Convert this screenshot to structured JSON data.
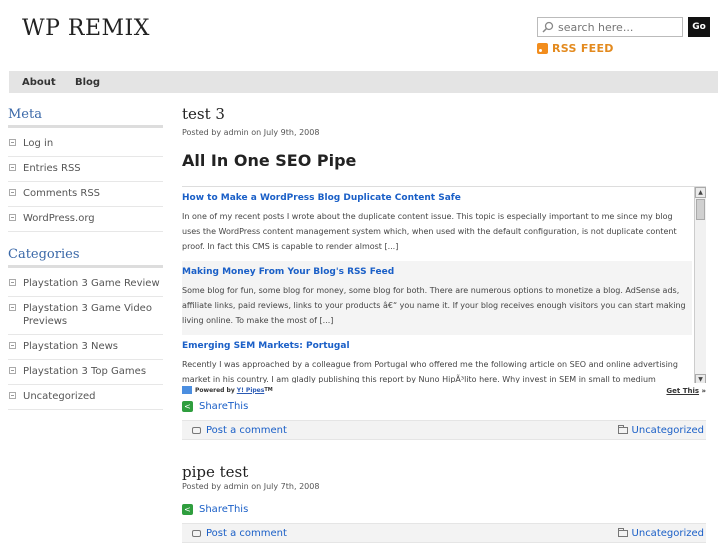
{
  "header": {
    "logo": "WP REMIX",
    "search_placeholder": "search here...",
    "go_label": "Go",
    "rss_label": "RSS FEED"
  },
  "nav": {
    "about": "About",
    "blog": "Blog"
  },
  "sidebar": {
    "meta_title": "Meta",
    "meta_items": [
      "Log in",
      "Entries RSS",
      "Comments RSS",
      "WordPress.org"
    ],
    "categories_title": "Categories",
    "category_items": [
      "Playstation 3 Game Review",
      "Playstation 3 Game Video Previews",
      "Playstation 3 News",
      "Playstation 3 Top Games",
      "Uncategorized"
    ]
  },
  "posts": [
    {
      "title": "test 3",
      "meta": "Posted by admin on July 9th, 2008",
      "pipe_title": "All In One SEO Pipe",
      "pipe_items": [
        {
          "title": "How to Make a WordPress Blog Duplicate Content Safe",
          "desc": "In one of my recent posts I wrote about the duplicate content issue. This topic is especially important to me since my blog uses the WordPress content management system which, when used with the default configuration, is not duplicate content proof. In fact this CMS is capable to render almost [...]"
        },
        {
          "title": "Making Money From Your Blog's RSS Feed",
          "desc": "Some blog for fun, some blog for money, some blog for both. There are numerous options to monetize a blog. AdSense ads, affiliate links, paid reviews, links to your products â€“ you name it. If your blog receives enough visitors you can start making living online. To make the most of [...]"
        },
        {
          "title": "Emerging SEM Markets: Portugal",
          "desc": "Recently I was approached by a colleague from Portugal who offered me the following article on SEO and online advertising market in his country. I am gladly publishing this report by Nuno HipÃ³lito here. Why invest in SEM in small to medium European markets"
        }
      ],
      "powered_label": "Powered by",
      "powered_link": "Y! Pipes",
      "powered_tm": "TM",
      "get_this": "Get This",
      "get_this_arrow": "»",
      "share": "ShareThis",
      "comment_link": "Post a comment",
      "category": "Uncategorized"
    },
    {
      "title": "pipe test",
      "meta": "Posted by admin on July 7th, 2008",
      "share": "ShareThis",
      "comment_link": "Post a comment",
      "category": "Uncategorized"
    }
  ],
  "colors": {
    "link": "#1a5fc7",
    "sidebar_heading": "#3a68a8",
    "rss": "#e38a1e",
    "nav_bg": "#e4e4e4"
  }
}
